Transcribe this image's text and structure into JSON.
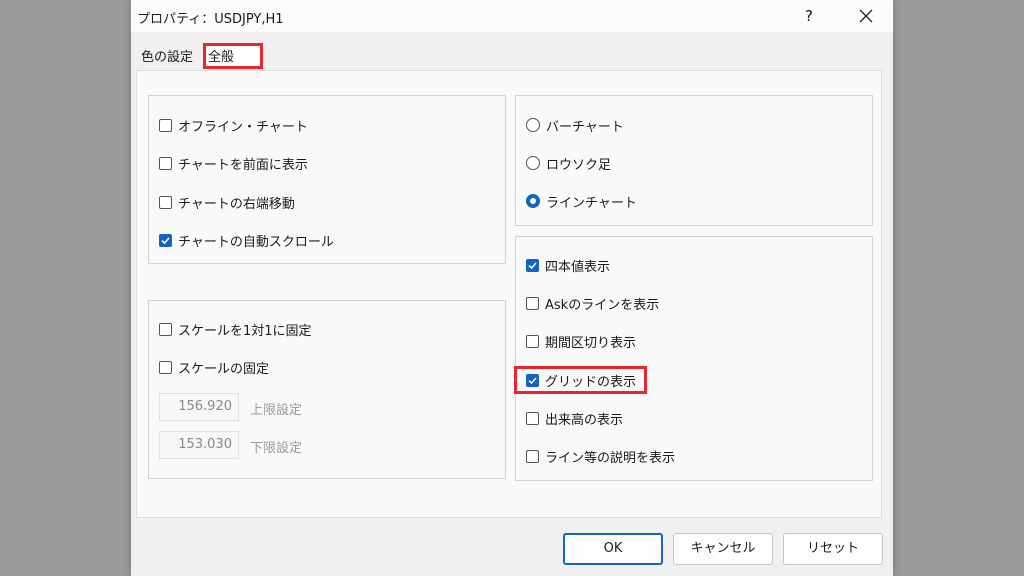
{
  "window": {
    "title": "プロパティ：USDJPY,H1",
    "help": "?"
  },
  "tabs": {
    "colors": "色の設定",
    "general": "全般"
  },
  "group_chart": {
    "items": [
      {
        "label": "オフライン・チャート",
        "checked": false
      },
      {
        "label": "チャートを前面に表示",
        "checked": false
      },
      {
        "label": "チャートの右端移動",
        "checked": false
      },
      {
        "label": "チャートの自動スクロール",
        "checked": true
      }
    ]
  },
  "group_scale": {
    "items": [
      {
        "label": "スケールを1対1に固定",
        "checked": false
      },
      {
        "label": "スケールの固定",
        "checked": false
      }
    ],
    "upper": {
      "value": "156.920",
      "label": "上限設定"
    },
    "lower": {
      "value": "153.030",
      "label": "下限設定"
    }
  },
  "group_type": {
    "items": [
      {
        "label": "バーチャート",
        "selected": false
      },
      {
        "label": "ロウソク足",
        "selected": false
      },
      {
        "label": "ラインチャート",
        "selected": true
      }
    ]
  },
  "group_display": {
    "items": [
      {
        "label": "四本値表示",
        "checked": true
      },
      {
        "label": "Askのラインを表示",
        "checked": false
      },
      {
        "label": "期間区切り表示",
        "checked": false
      },
      {
        "label": "グリッドの表示",
        "checked": true
      },
      {
        "label": "出来高の表示",
        "checked": false
      },
      {
        "label": "ライン等の説明を表示",
        "checked": false
      }
    ]
  },
  "buttons": {
    "ok": "OK",
    "cancel": "キャンセル",
    "reset": "リセット"
  },
  "colors": {
    "accent": "#1565c0",
    "highlight": "#e8262b"
  }
}
